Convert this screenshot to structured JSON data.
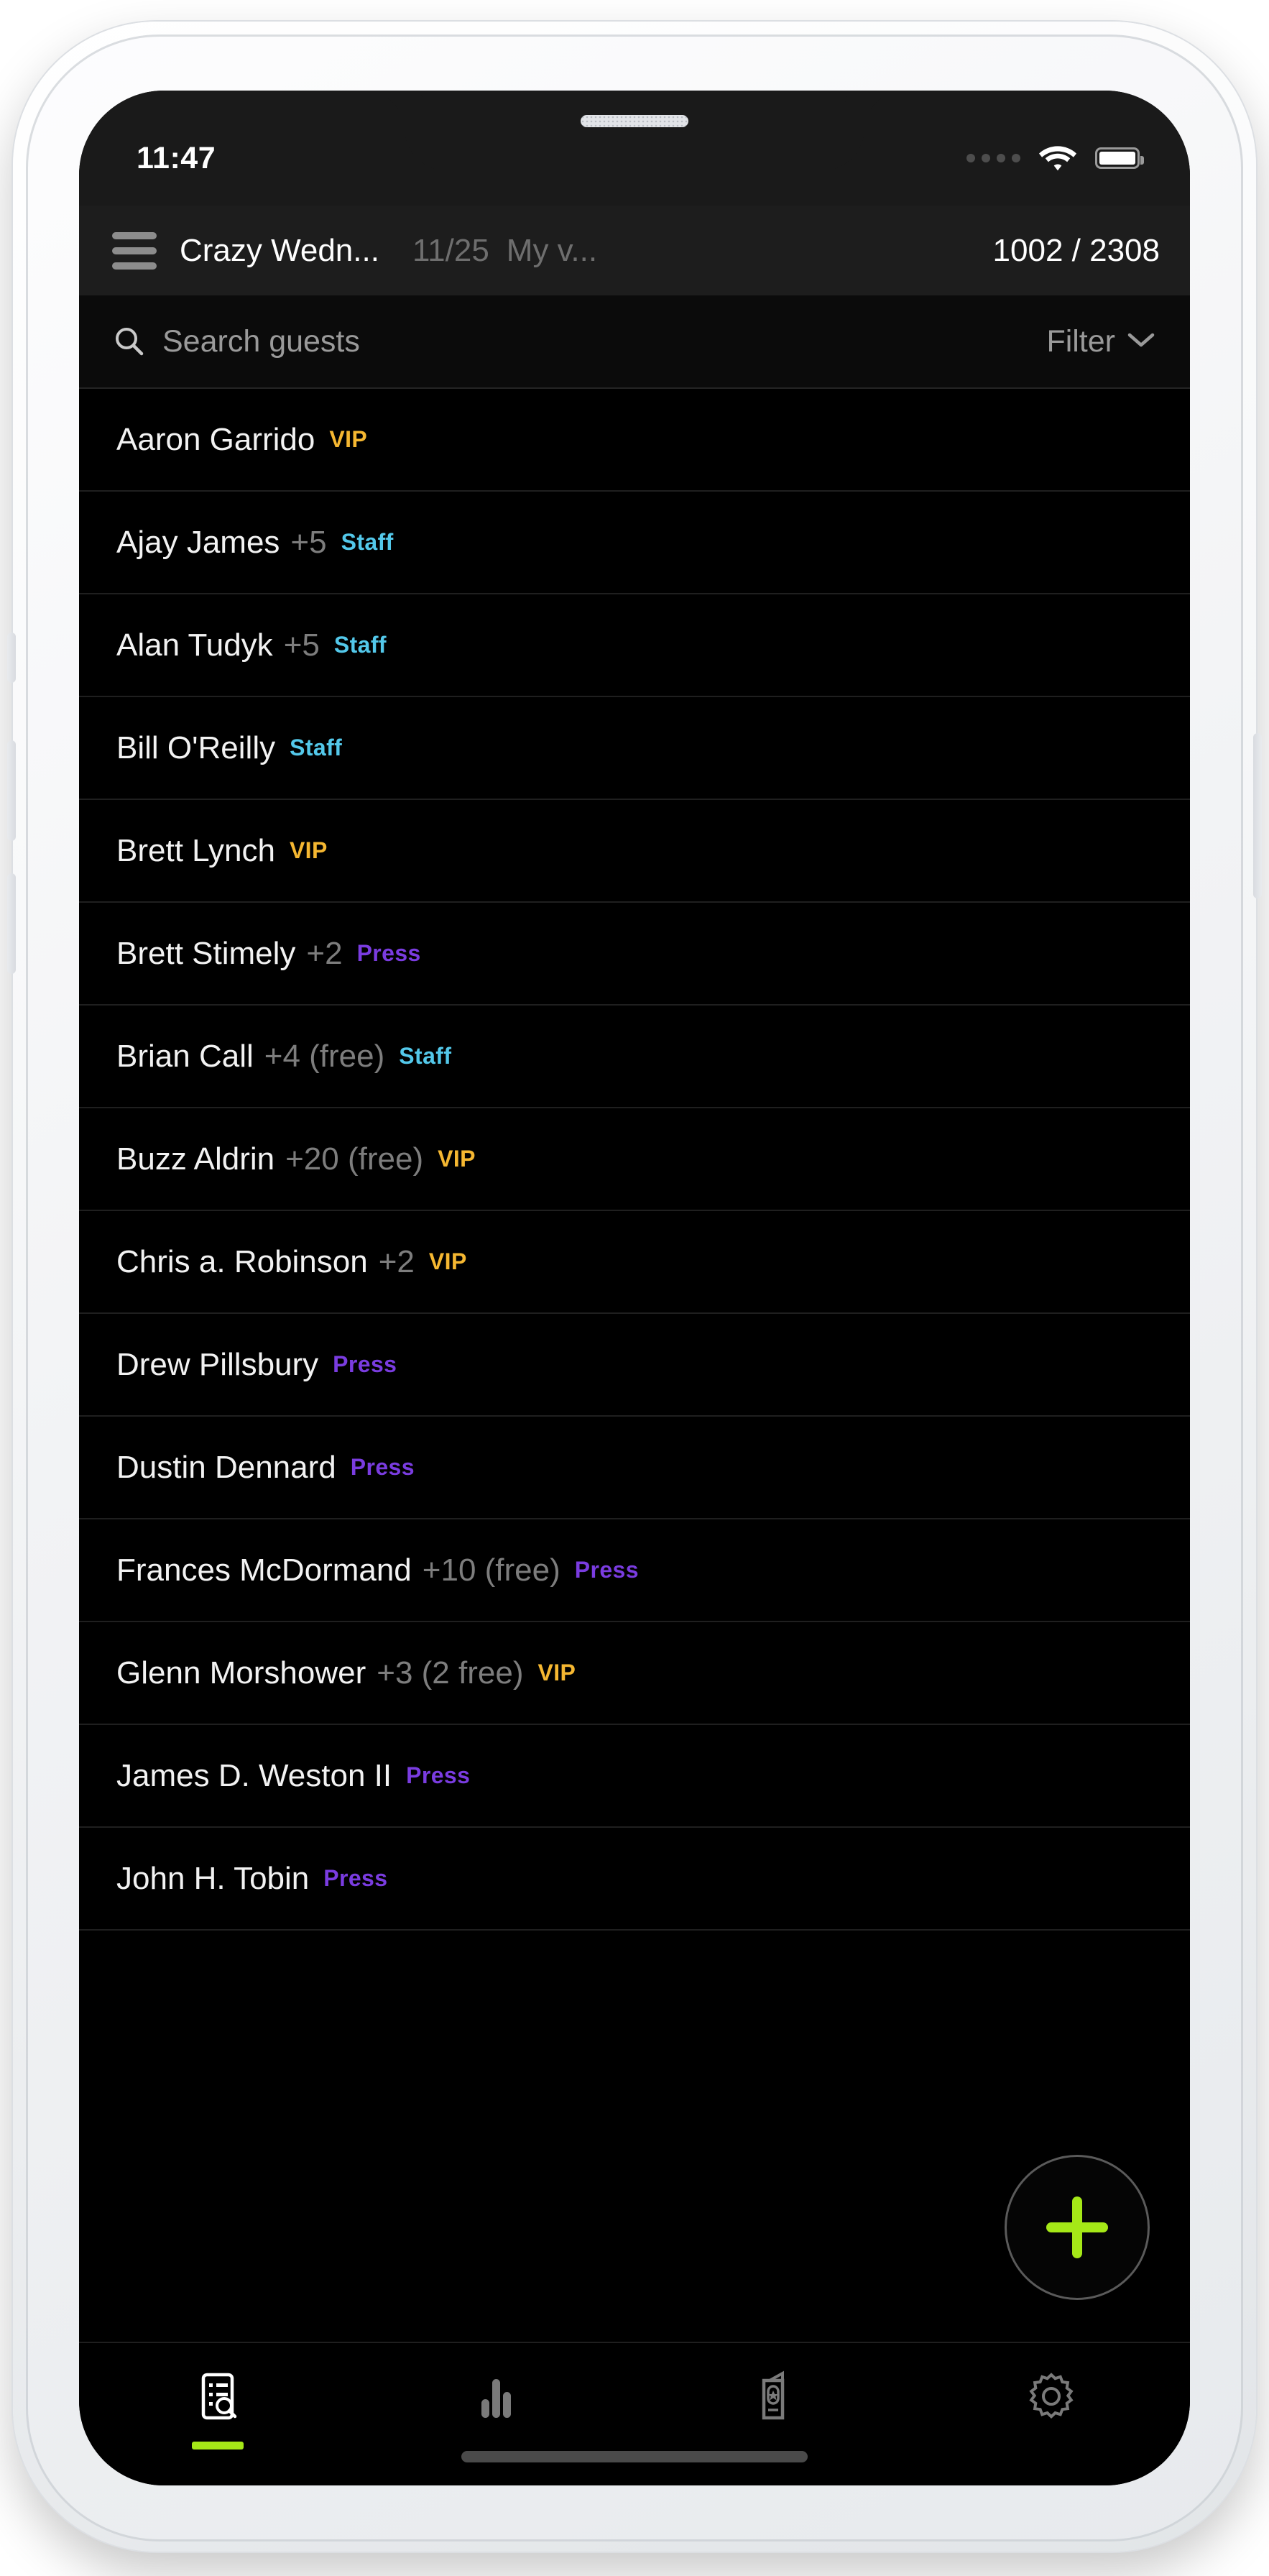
{
  "status_bar": {
    "time": "11:47",
    "signal_icon": "signal-dots-icon",
    "wifi_icon": "wifi-icon",
    "battery_icon": "battery-full-icon"
  },
  "header": {
    "menu_icon": "hamburger-menu-icon",
    "event_title": "Crazy Wedn...",
    "date": "11/25",
    "venue": "My v...",
    "guest_count": "1002 / 2308"
  },
  "search": {
    "icon": "search-icon",
    "placeholder": "Search guests",
    "value": "",
    "filter_label": "Filter",
    "filter_chevron_icon": "chevron-down-icon"
  },
  "colors": {
    "vip": "#f5b731",
    "staff": "#53c8ea",
    "press": "#7a3ce0",
    "accent": "#a5e817",
    "screen_bg": "#000000",
    "header_bg": "#1d1d1d"
  },
  "guests": [
    {
      "name": "Aaron Garrido",
      "extra": "",
      "tag": "VIP"
    },
    {
      "name": "Ajay James",
      "extra": "+5",
      "tag": "Staff"
    },
    {
      "name": "Alan Tudyk",
      "extra": "+5",
      "tag": "Staff"
    },
    {
      "name": "Bill O'Reilly",
      "extra": "",
      "tag": "Staff"
    },
    {
      "name": "Brett Lynch",
      "extra": "",
      "tag": "VIP"
    },
    {
      "name": "Brett Stimely",
      "extra": "+2",
      "tag": "Press"
    },
    {
      "name": "Brian Call",
      "extra": "+4 (free)",
      "tag": "Staff"
    },
    {
      "name": "Buzz Aldrin",
      "extra": "+20 (free)",
      "tag": "VIP"
    },
    {
      "name": "Chris a. Robinson",
      "extra": "+2",
      "tag": "VIP"
    },
    {
      "name": "Drew Pillsbury",
      "extra": "",
      "tag": "Press"
    },
    {
      "name": "Dustin Dennard",
      "extra": "",
      "tag": "Press"
    },
    {
      "name": "Frances McDormand",
      "extra": "+10 (free)",
      "tag": "Press"
    },
    {
      "name": "Glenn Morshower",
      "extra": "+3 (2 free)",
      "tag": "VIP"
    },
    {
      "name": "James D. Weston II",
      "extra": "",
      "tag": "Press"
    },
    {
      "name": "John H. Tobin",
      "extra": "",
      "tag": "Press"
    }
  ],
  "fab": {
    "icon": "plus-icon",
    "label": "+"
  },
  "bottom_nav": {
    "items": [
      {
        "icon": "guest-list-search-icon",
        "active": true
      },
      {
        "icon": "bar-chart-icon",
        "active": false
      },
      {
        "icon": "ticket-star-icon",
        "active": false
      },
      {
        "icon": "gear-icon",
        "active": false
      }
    ]
  }
}
